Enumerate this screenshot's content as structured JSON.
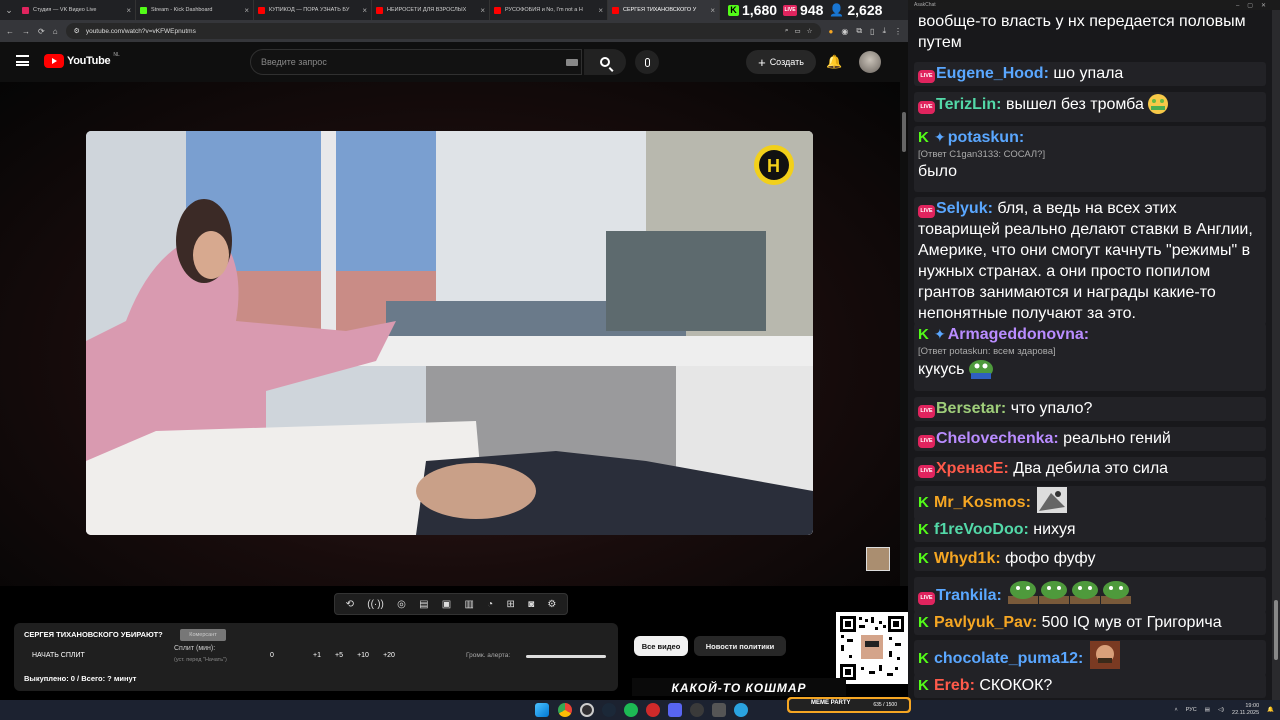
{
  "browser": {
    "tabs": [
      {
        "title": "Студия — VK Видео Live",
        "favicon_color": "#e0245e"
      },
      {
        "title": "Stream - Kick Dashboard",
        "favicon_color": "#53fc18"
      },
      {
        "title": "КУПИКОД — ПОРА УЗНАТЬ БУ",
        "favicon_color": "#ff0000"
      },
      {
        "title": "НЕЙРОСЕТИ ДЛЯ ВЗРОСЛЫХ",
        "favicon_color": "#ff0000"
      },
      {
        "title": "РУСОФОБИЯ и No, I'm not a H",
        "favicon_color": "#ff0000"
      },
      {
        "title": "СЕРГЕЯ ТИХАНОВСКОГО У",
        "favicon_color": "#ff0000",
        "active": true
      }
    ],
    "url": "youtube.com/watch?v=vKFWEpnutms",
    "nav_icons": [
      "back-icon",
      "forward-icon",
      "reload-icon",
      "home-icon"
    ]
  },
  "stats": {
    "kick_viewers": "1,680",
    "vk_viewers": "948",
    "total_viewers": "2,628"
  },
  "youtube": {
    "logo_text": "YouTube",
    "country_code": "NL",
    "search_placeholder": "Введите запрос",
    "create_label": "Создать"
  },
  "extension_toolbar": {
    "icons": [
      "loop-icon",
      "broadcast-icon",
      "camera-eye-icon",
      "film-icon",
      "picture-icon",
      "filmstrip-icon",
      "speed-icon",
      "screenshot-frame-icon",
      "camera-icon",
      "gear-icon"
    ]
  },
  "tracker": {
    "title": "СЕРГЕЯ ТИХАНОВСКОГО УБИРАЮТ?",
    "chip": "Комерсант",
    "start_split": "НАЧАТЬ СПЛИТ",
    "split_label": "Сплит (мин):",
    "split_hint": "(уст. перед \"Начать\")",
    "buttons": [
      "0",
      "+1",
      "+5",
      "+10",
      "+20"
    ],
    "volume_label": "Громк. алерта:",
    "footer": "Выкуплено: 0 / Всего: ? минут"
  },
  "filters": {
    "all": "Все видео",
    "news": "Новости политики"
  },
  "banner_text": "КАКОЙ-ТО КОШМАР",
  "chat": {
    "window_title": "AsakChat",
    "messages": [
      {
        "platform": "none",
        "user": "",
        "color": "#ffffff",
        "text": "вообще-то власть у нх передается половым путем",
        "plain": true
      },
      {
        "platform": "vk",
        "user": "Eugene_Hood:",
        "color": "#5aa7ff",
        "text": "шо упала"
      },
      {
        "platform": "vk",
        "user": "TerizLin:",
        "color": "#53d9a8",
        "text": "вышел без тромба",
        "emote": "money-face-emote"
      },
      {
        "platform": "kick",
        "user": "potaskun:",
        "color": "#5aa7ff",
        "badge": "sword-badge-icon",
        "reply": "[Ответ C1gan3133: СОСАЛ?]",
        "text": "было"
      },
      {
        "platform": "vk",
        "user": "Selyuk:",
        "color": "#5aa7ff",
        "text": "бля, а ведь на всех этих товарищей реально делают ставки в Англии, Америке, что они смогут качнуть \"режимы\" в нужных странах. а они просто попилом грантов занимаются и награды какие-то непонятные получают за это."
      },
      {
        "platform": "kick",
        "user": "Armageddonovna:",
        "color": "#b98cff",
        "badge": "sword-badge-icon",
        "reply": "[Ответ potaskun: всем здарова]",
        "text": "кукусь",
        "emote": "pepe-emote"
      },
      {
        "platform": "vk",
        "user": "Bersetar:",
        "color": "#9fce7a",
        "text": "что упало?"
      },
      {
        "platform": "vk",
        "user": "Chelovechenka:",
        "color": "#b98cff",
        "text": "реально гений"
      },
      {
        "platform": "vk",
        "user": "ХренасЕ:",
        "color": "#ff5a4a",
        "text": "Два дебила это сила"
      },
      {
        "platform": "kick",
        "user": "Mr_Kosmos:",
        "color": "#f5a623",
        "text": "",
        "emote": "photo-emote"
      },
      {
        "platform": "kick",
        "user": "f1reVooDoo:",
        "color": "#53d9a8",
        "text": "нихуя"
      },
      {
        "platform": "kick",
        "user": "Whyd1k:",
        "color": "#f5a623",
        "text": "фофо фуфу"
      },
      {
        "platform": "vk",
        "user": "Trankila:",
        "color": "#5aa7ff",
        "text": "",
        "emote": "pepe-row-emote"
      },
      {
        "platform": "kick",
        "user": "Pavlyuk_Pav:",
        "color": "#f5a623",
        "text": "500 IQ мув от Григорича"
      },
      {
        "platform": "kick",
        "user": "chocolate_puma12:",
        "color": "#5aa7ff",
        "text": "",
        "emote": "face-emote"
      },
      {
        "platform": "kick",
        "user": "Ereb:",
        "color": "#ff5a4a",
        "text": "СКОКОК?"
      }
    ]
  },
  "taskbar": {
    "lang": "РУС",
    "time": "19:00",
    "date": "22.11.2025",
    "live_bar_label": "MEME PARTY",
    "live_bar_value": "635 / 1500"
  },
  "colors": {
    "yt_red": "#ff0000",
    "kick_green": "#53fc18",
    "vk_pink": "#e0245e",
    "chat_bg": "#18181b"
  }
}
